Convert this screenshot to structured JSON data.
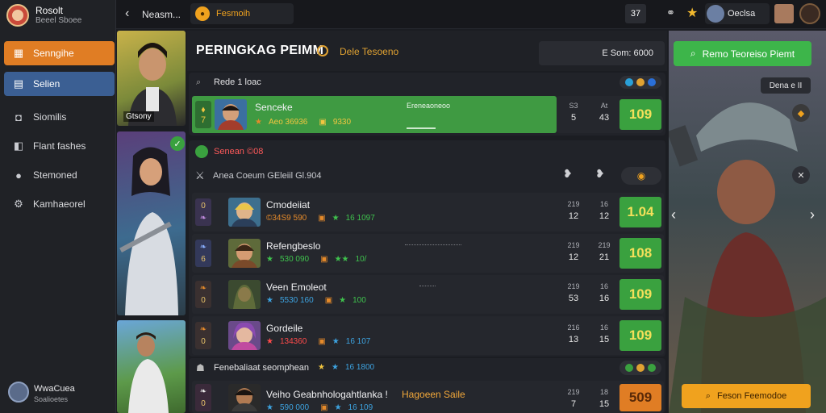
{
  "colors": {
    "accent_orange": "#e07d24",
    "accent_blue": "#3b5f93",
    "green": "#3aa13f",
    "score_yellow": "#f3e05a"
  },
  "profile": {
    "name": "Rosolt",
    "sub": "Beeel Sboee"
  },
  "sidebar": {
    "items": [
      {
        "label": "Senngihe",
        "icon": "grid-icon"
      },
      {
        "label": "Selien",
        "icon": "list-icon"
      },
      {
        "label": "Siomilis",
        "icon": "headset-icon"
      },
      {
        "label": "Flant fashes",
        "icon": "box-icon"
      },
      {
        "label": "Stemoned",
        "icon": "user-icon"
      },
      {
        "label": "Kamhaeorel",
        "icon": "gear-icon"
      }
    ],
    "footer": {
      "name": "WwaCuea",
      "sub": "Soalioetes"
    }
  },
  "topbar": {
    "back_label": "Neasm...",
    "tab_label": "Fesmoih",
    "count": "37",
    "user_label": "Oeclsa"
  },
  "hero": {
    "caption": "Gtsony"
  },
  "header": {
    "title": "PERINGKAG PEIMM",
    "subtitle": "Dele Tesoeno",
    "season_label": "E Som: 6000",
    "action_label": "Remo Teoreiso Piemt"
  },
  "top_section": {
    "label": "Rede 1 loac",
    "player": {
      "rank": "7",
      "name": "Senceke",
      "stat_a": "Aeo 36936",
      "stat_b": "9330",
      "mid_label": "Ereneaoneoo",
      "col1_small": "S3",
      "col1": "5",
      "col2_small": "At",
      "col2": "43",
      "score": "109"
    }
  },
  "section2": {
    "label": "Senean ©08",
    "header": "Anea Coeum GEleiil Gl.904",
    "rows": [
      {
        "rank": "0",
        "name": "Cmodeiiat",
        "stat_a": "©34S9 590",
        "stat_b": "16 1097",
        "col1_small": "219",
        "col1": "12",
        "col2_small": "16",
        "col2": "12",
        "score": "1.04"
      },
      {
        "rank": "6",
        "name": "Refengbeslo",
        "stat_a": "530 090",
        "stat_b": "10/",
        "col1_small": "219",
        "col1": "12",
        "col2_small": "219",
        "col2": "21",
        "score": "108"
      },
      {
        "rank": "0",
        "name": "Veen Emoleot",
        "stat_a": "5530 160",
        "stat_b": "100",
        "col1_small": "219",
        "col1": "53",
        "col2_small": "16",
        "col2": "16",
        "score": "109"
      },
      {
        "rank": "0",
        "name": "Gordeile",
        "stat_a": "134360",
        "stat_b": "16 107",
        "col1_small": "216",
        "col1": "13",
        "col2_small": "16",
        "col2": "15",
        "score": "109"
      }
    ]
  },
  "section3": {
    "label": "Fenebaliaat seomphean",
    "stat": "16 1800",
    "row": {
      "rank": "0",
      "name": "Veiho Geabnhologahtlanka !",
      "highlight": "Hagoeen Saile",
      "stat_a": "590 000",
      "stat_b": "16 109",
      "col1_small": "219",
      "col1": "7",
      "col2_small": "18",
      "col2": "15",
      "score": "509"
    }
  },
  "right_panel": {
    "small_button": "Dena e II",
    "bottom_button": "Feson Feemodoe"
  }
}
